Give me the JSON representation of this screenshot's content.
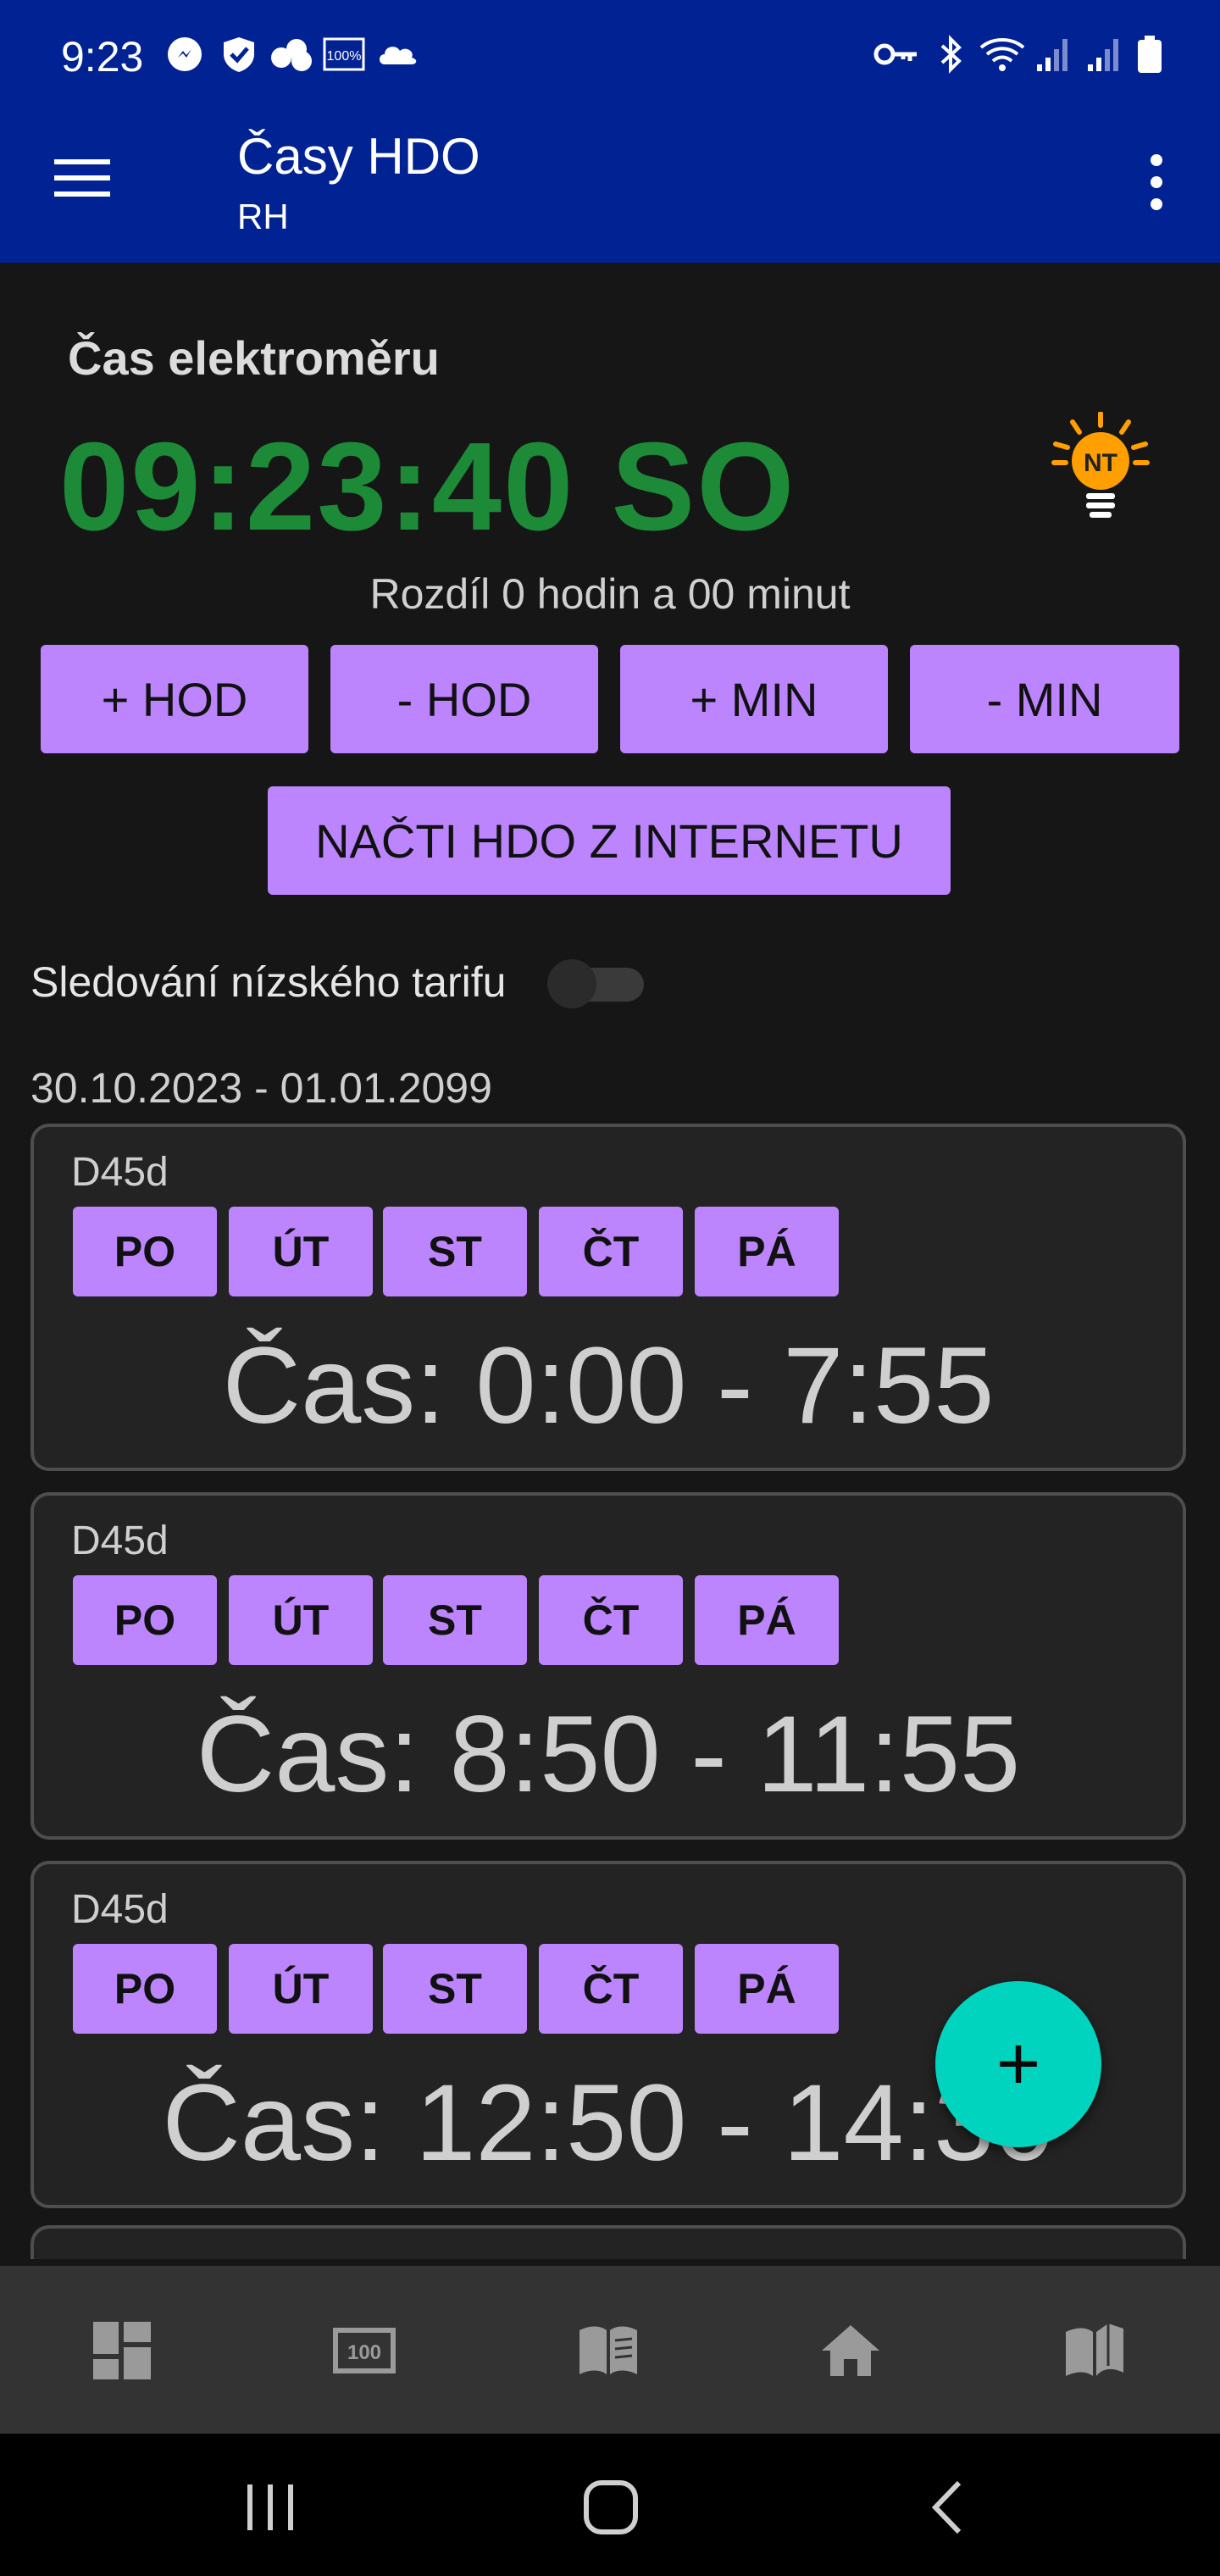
{
  "status_bar": {
    "time": "9:23",
    "icons_left": [
      "messenger-icon",
      "shield-check-icon",
      "cloud-group-icon",
      "battery-100-box-icon",
      "cloud-icon"
    ],
    "icons_right": [
      "key-icon",
      "bluetooth-icon",
      "wifi-icon",
      "signal-icon",
      "signal-icon-2",
      "battery-icon"
    ]
  },
  "app_bar": {
    "title": "Časy HDO",
    "subtitle": "RH",
    "menu_icon": "hamburger-menu-icon",
    "more_icon": "more-vert-icon",
    "background": "#012293"
  },
  "meter": {
    "label": "Čas elektroměru",
    "time": "09:23:40 SO",
    "time_color": "#1c8a37",
    "tariff_badge": "NT",
    "tariff_color": "#ff9f00",
    "difference": "Rozdíl 0 hodin a 00 minut"
  },
  "adjust_buttons": {
    "hour_plus": "+ HOD",
    "hour_minus": "- HOD",
    "min_plus": "+ MIN",
    "min_minus": "- MIN"
  },
  "load_button": "NAČTI HDO Z INTERNETU",
  "tracking": {
    "label": "Sledování nízského tarifu",
    "enabled": false
  },
  "date_range": "30.10.2023 - 01.01.2099",
  "cards": [
    {
      "code": "D45d",
      "days": [
        "PO",
        "ÚT",
        "ST",
        "ČT",
        "PÁ"
      ],
      "time": "Čas: 0:00 - 7:55"
    },
    {
      "code": "D45d",
      "days": [
        "PO",
        "ÚT",
        "ST",
        "ČT",
        "PÁ"
      ],
      "time": "Čas: 8:50 - 11:55"
    },
    {
      "code": "D45d",
      "days": [
        "PO",
        "ÚT",
        "ST",
        "ČT",
        "PÁ"
      ],
      "time": "Čas: 12:50 - 14:30"
    }
  ],
  "fab": {
    "label": "+",
    "color": "#00d3be"
  },
  "bottom_nav": [
    "dashboard-icon",
    "meter-counter-icon",
    "book-list-icon",
    "home-icon",
    "book-map-icon"
  ],
  "accent": "#bc85fe"
}
